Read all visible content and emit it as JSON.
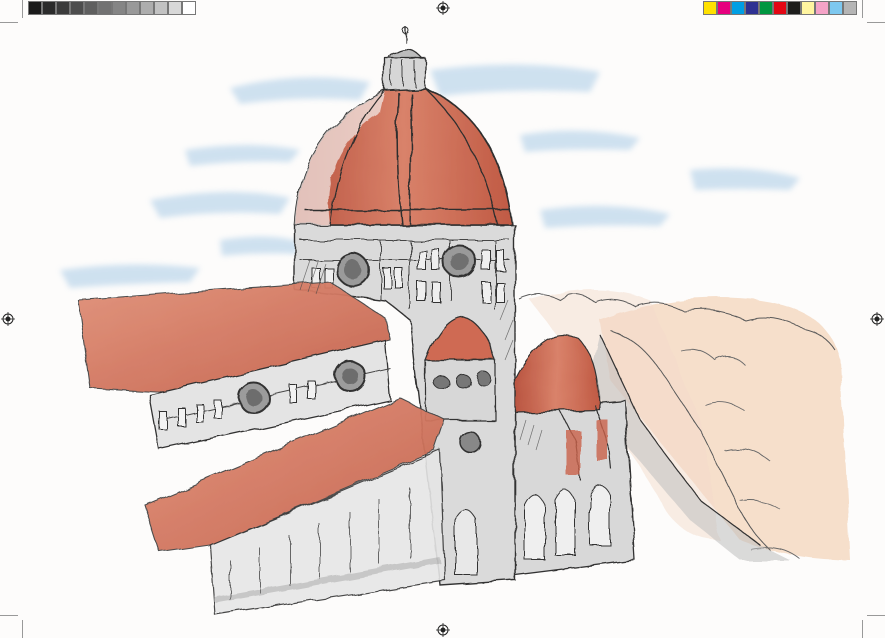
{
  "print_marks": {
    "grayscale_patches": [
      "#1a1a1a",
      "#2b2b2b",
      "#3b3b3b",
      "#4d4d4d",
      "#5f5f5f",
      "#727272",
      "#858585",
      "#999999",
      "#adadad",
      "#c2c2c2",
      "#d8d8d8",
      "#ffffff"
    ],
    "color_patches": [
      "#ffe100",
      "#e6007e",
      "#009fe3",
      "#2e3192",
      "#009640",
      "#e30613",
      "#1d1d1b",
      "#fff5a0",
      "#f5a3c7",
      "#7ec8ef",
      "#b5b5b5"
    ]
  },
  "colors": {
    "terracotta": "#c9624a",
    "terracotta_light": "#e0937c",
    "sky_wash": "#a9cbe6",
    "ink": "#3a3a3a",
    "stone_gray": "#8c8c8c",
    "foliage_peach": "#f0c6a4"
  }
}
